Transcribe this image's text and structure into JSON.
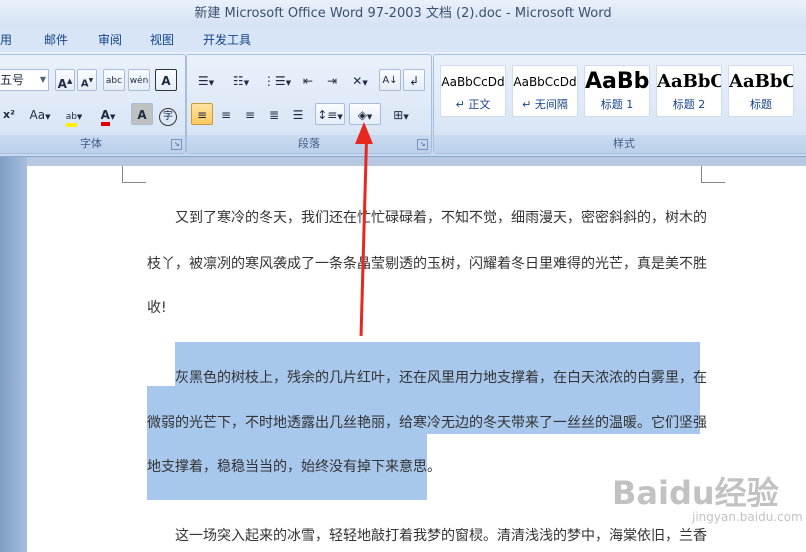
{
  "window": {
    "title": "新建 Microsoft Office Word 97-2003 文档 (2).doc - Microsoft Word"
  },
  "ribbon_tabs": [
    "用",
    "邮件",
    "审阅",
    "视图",
    "开发工具"
  ],
  "font_group": {
    "label": "字体",
    "font_size": "五号",
    "grow_font": "A",
    "shrink_font": "A",
    "phonetic": "abc",
    "enclose_char": "wén",
    "char_border": "A",
    "superscript": "x²",
    "change_case": "Aa",
    "highlight_label": "ab",
    "font_color_label": "A",
    "char_shading": "A",
    "enclose": "字"
  },
  "paragraph_group": {
    "label": "段落"
  },
  "styles_group": {
    "label": "样式",
    "styles": [
      {
        "sample": "AaBbCcDd",
        "name": "↵ 正文"
      },
      {
        "sample": "AaBbCcDd",
        "name": "↵ 无间隔"
      },
      {
        "sample": "AaBb",
        "name": "标题 1"
      },
      {
        "sample": "AaBbC",
        "name": "标题 2"
      },
      {
        "sample": "AaBbC",
        "name": "标题"
      }
    ]
  },
  "document": {
    "lines": [
      "又到了寒冷的冬天，我们还在忙忙碌碌着，不知不觉，细雨漫天，密密斜斜的，树木的",
      "枝丫，被凛冽的寒风袭成了一条条晶莹剔透的玉树，闪耀着冬日里难得的光芒，真是美不胜",
      "收!",
      "灰黑色的树枝上，残余的几片红叶，还在风里用力地支撑着，在白天浓浓的白雾里，在",
      "微弱的光芒下，不时地透露出几丝艳丽，给寒冷无边的冬天带来了一丝丝的温暖。它们坚强",
      "地支撑着，稳稳当当的，始终没有掉下来意思。",
      "这一场突入起来的冰雪，轻轻地敲打着我梦的窗棂。清清浅浅的梦中，海棠依旧，兰香"
    ]
  },
  "watermark": {
    "brand": "Baidu",
    "brand_cn": "经验",
    "url": "jingyan.baidu.com"
  },
  "colors": {
    "highlight": "#a7c7ec",
    "arrow": "#e8281e",
    "accent": "#15428b"
  }
}
